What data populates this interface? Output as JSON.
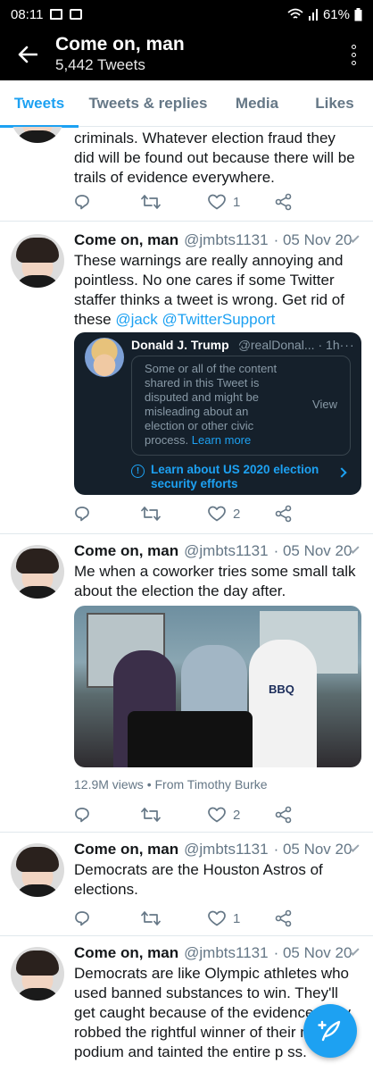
{
  "status_bar": {
    "time": "08:11",
    "battery": "61%"
  },
  "header": {
    "title": "Come on, man",
    "subtitle": "5,442 Tweets"
  },
  "tabs": [
    {
      "label": "Tweets",
      "active": true
    },
    {
      "label": "Tweets & replies",
      "active": false
    },
    {
      "label": "Media",
      "active": false
    },
    {
      "label": "Likes",
      "active": false
    }
  ],
  "tweets": [
    {
      "text": "criminals. Whatever election fraud they did will be found out because there will be trails of evidence everywhere.",
      "replies": "",
      "retweets": "",
      "likes": "1"
    },
    {
      "name": "Come on, man",
      "handle": "@jmbts1131",
      "date": "· 05 Nov 20",
      "text": "These warnings are really annoying and pointless. No one cares if some Twitter staffer thinks a tweet is wrong. Get rid of these ",
      "mentions": [
        "@jack",
        "@TwitterSupport"
      ],
      "quote": {
        "name": "Donald J. Trump",
        "handle": "@realDonal...",
        "time": "· 1h",
        "more": "···",
        "notice": "Some or all of the content shared in this Tweet is disputed and might be misleading about an election or other civic process.",
        "notice_link": "Learn more",
        "view_label": "View",
        "learn_label": "Learn about US 2020 election security efforts"
      },
      "replies": "",
      "retweets": "",
      "likes": "2"
    },
    {
      "name": "Come on, man",
      "handle": "@jmbts1131",
      "date": "· 05 Nov 20",
      "text": "Me when a coworker tries some small talk about the election the day after.",
      "media_caption": "12.9M views • From Timothy Burke",
      "media_text": "BBQ",
      "replies": "",
      "retweets": "",
      "likes": "2"
    },
    {
      "name": "Come on, man",
      "handle": "@jmbts1131",
      "date": "· 05 Nov 20",
      "text": "Democrats are the Houston Astros of elections.",
      "replies": "",
      "retweets": "",
      "likes": "1"
    },
    {
      "name": "Come on, man",
      "handle": "@jmbts1131",
      "date": "· 05 Nov 20",
      "text": "Democrats are like Olympic athletes who used banned substances to win. They'll get caught because of the evidence but y robbed the rightful winner of their m at the podium and tainted the entire p ss."
    }
  ],
  "colors": {
    "accent": "#1da1f2",
    "header_bg": "#000000",
    "quote_bg": "#15202b"
  },
  "icons": [
    "back-arrow-icon",
    "more-vert-icon",
    "reply-icon",
    "retweet-icon",
    "like-icon",
    "share-icon",
    "compose-icon"
  ]
}
